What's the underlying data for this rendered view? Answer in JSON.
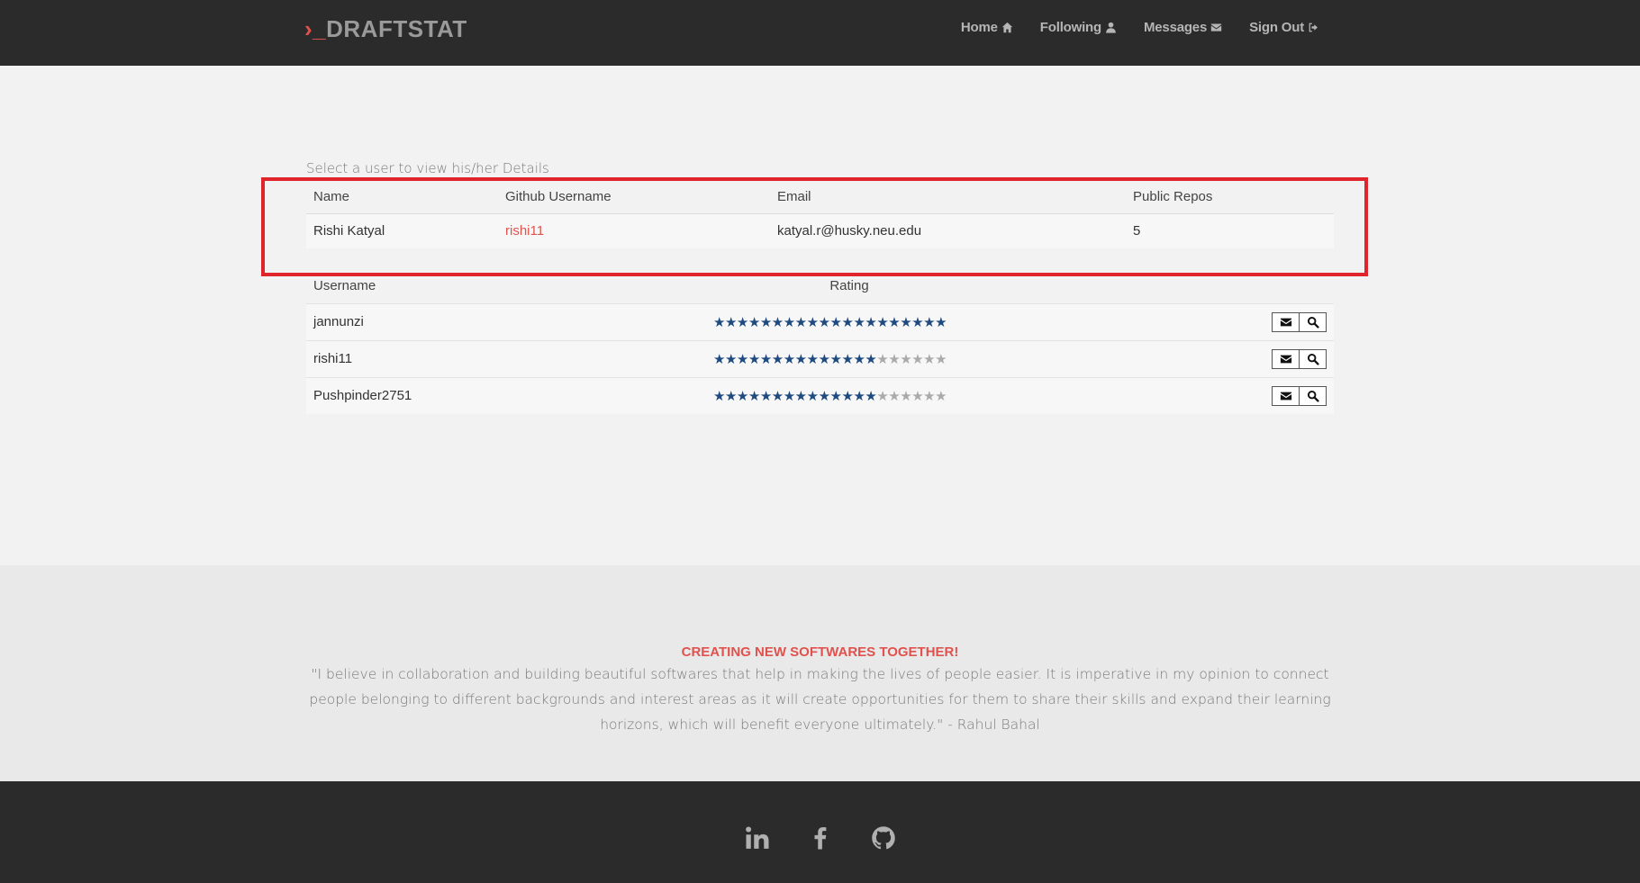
{
  "brand": {
    "prompt": "›_",
    "name": "DRAFTSTAT"
  },
  "nav": [
    {
      "label": "Home",
      "icon": "home-icon"
    },
    {
      "label": "Following",
      "icon": "user-icon"
    },
    {
      "label": "Messages",
      "icon": "envelope-icon"
    },
    {
      "label": "Sign Out",
      "icon": "sign-out-icon"
    }
  ],
  "main": {
    "hint": "Select a user to view his/her Details",
    "details": {
      "headers": [
        "Name",
        "Github Username",
        "Email",
        "Public Repos"
      ],
      "row": {
        "name": "Rishi Katyal",
        "github": "rishi11",
        "email": "katyal.r@husky.neu.edu",
        "repos": "5"
      }
    },
    "users": {
      "headers": {
        "username": "Username",
        "rating": "Rating"
      },
      "star_total": 20,
      "rows": [
        {
          "username": "jannunzi",
          "rating": 20
        },
        {
          "username": "rishi11",
          "rating": 14
        },
        {
          "username": "Pushpinder2751",
          "rating": 14
        }
      ]
    }
  },
  "quote": {
    "title": "CREATING NEW SOFTWARES TOGETHER!",
    "text": "\"I believe in collaboration and building beautiful softwares that help in making the lives of people easier. It is imperative in my opinion to connect people belonging to different backgrounds and interest areas as it will create opportunities for them to share their skills and expand their learning horizons, which will benefit everyone ultimately.\" - Rahul Bahal"
  },
  "footer": {
    "socials": [
      "linkedin-icon",
      "facebook-icon",
      "github-icon"
    ]
  },
  "colors": {
    "accent": "#e0524d",
    "star_on": "#1e4a80",
    "star_off": "#aaaaaa",
    "highlight": "#e0242b"
  }
}
